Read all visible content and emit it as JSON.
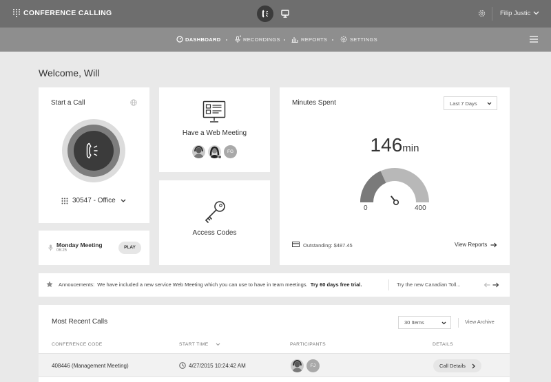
{
  "app": {
    "title": "CONFERENCE CALLING",
    "user_name": "Filip Justic"
  },
  "nav": {
    "items": [
      {
        "label": "DASHBOARD",
        "icon": "dashboard-icon",
        "active": true
      },
      {
        "label": "RECORDINGS",
        "icon": "microphone-icon",
        "active": false
      },
      {
        "label": "REPORTS",
        "icon": "bar-chart-icon",
        "active": false
      },
      {
        "label": "SETTINGS",
        "icon": "gear-icon",
        "active": false
      }
    ]
  },
  "welcome": "Welcome, Will",
  "start_call": {
    "title": "Start a Call",
    "line": "30547 - Office"
  },
  "web_meeting": {
    "title": "Have a Web Meeting",
    "participant_initials": "FG"
  },
  "access_codes": {
    "title": "Access Codes"
  },
  "minutes": {
    "title": "Minutes Spent",
    "range": "Last 7 Days",
    "value": "146",
    "unit": "min",
    "gauge_min": "0",
    "gauge_max": "400",
    "gauge_value": 146,
    "outstanding": "Outstanding: $487.45",
    "view_reports": "View Reports"
  },
  "recording": {
    "title": "Monday Meeting",
    "duration": "06:25",
    "play_label": "PLAY"
  },
  "announcement": {
    "label": "Annoucements:",
    "text": "We have included a new service Web Meeting which you can use to have in team meetings.",
    "cta": "Try 60 days free trial.",
    "next": "Try the new Canadian Toll..."
  },
  "recent_calls": {
    "title": "Most Recent Calls",
    "items_select": "30 Items",
    "view_archive": "View Archive",
    "columns": [
      "CONFERENCE CODE",
      "START TIME",
      "PARTICIPANTS",
      "DETAILS"
    ],
    "rows": [
      {
        "code": "408446 (Management Meeting)",
        "start": "4/27/2015 10:24:42 AM",
        "participant_initials": "FJ",
        "details_label": "Call Details"
      }
    ]
  },
  "colors": {
    "topbar": "#6e6e6e",
    "navbar": "#8e8e8e",
    "background": "#e9e9e9",
    "card": "#ffffff"
  }
}
